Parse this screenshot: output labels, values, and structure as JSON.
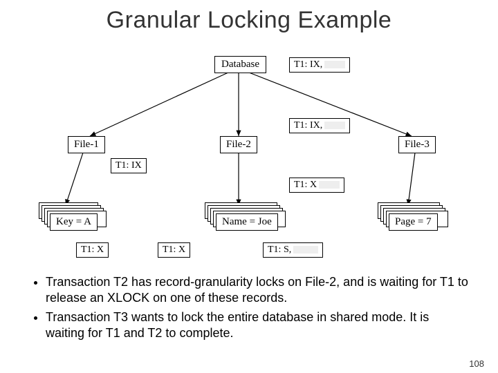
{
  "title": "Granular Locking Example",
  "nodes": {
    "database": "Database",
    "file1": "File-1",
    "file2": "File-2",
    "file3": "File-3",
    "keyA": "Key = A",
    "nameJoe": "Name = Joe",
    "page7": "Page = 7"
  },
  "locks": {
    "db_right": "T1: IX,",
    "file2_right": "T1: IX,",
    "file1_below": "T1: IX",
    "nameJoe_right": "T1: X",
    "keyA_below": "T1: X",
    "keyA_right": "T1: X",
    "nameJoe_below": "T1: S,"
  },
  "bullets": [
    "Transaction T2 has record-granularity locks on File-2, and is waiting for T1 to release an XLOCK on one of these records.",
    "Transaction T3 wants to lock the entire database in shared mode. It is waiting for T1 and T2 to complete."
  ],
  "page_number": "108"
}
